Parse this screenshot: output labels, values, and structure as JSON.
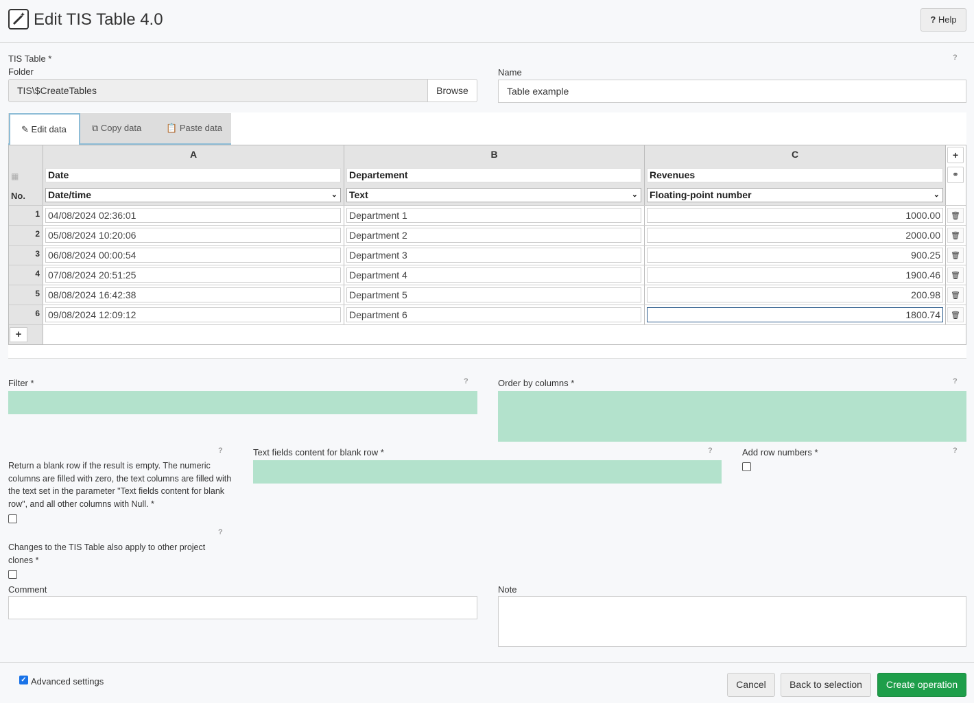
{
  "header": {
    "title": "Edit TIS Table 4.0",
    "help_label": "Help"
  },
  "form": {
    "tis_table_label": "TIS Table *",
    "folder_label": "Folder",
    "folder_value": "TIS\\$CreateTables",
    "browse_label": "Browse",
    "name_label": "Name",
    "name_value": "Table example"
  },
  "tabs": [
    {
      "label": "Edit data",
      "icon": "edit-icon"
    },
    {
      "label": "Copy data",
      "icon": "copy-icon"
    },
    {
      "label": "Paste data",
      "icon": "paste-icon"
    }
  ],
  "grid": {
    "no_label": "No.",
    "columns": [
      {
        "letter": "A",
        "name": "Date",
        "type": "Date/time"
      },
      {
        "letter": "B",
        "name": "Departement",
        "type": "Text"
      },
      {
        "letter": "C",
        "name": "Revenues",
        "type": "Floating-point number"
      }
    ],
    "rows": [
      {
        "no": "1",
        "a": "04/08/2024 02:36:01",
        "b": "Department 1",
        "c": "1000.00"
      },
      {
        "no": "2",
        "a": "05/08/2024 10:20:06",
        "b": "Department 2",
        "c": "2000.00"
      },
      {
        "no": "3",
        "a": "06/08/2024 00:00:54",
        "b": "Department 3",
        "c": "900.25"
      },
      {
        "no": "4",
        "a": "07/08/2024 20:51:25",
        "b": "Department 4",
        "c": "1900.46"
      },
      {
        "no": "5",
        "a": "08/08/2024 16:42:38",
        "b": "Department 5",
        "c": "200.98"
      },
      {
        "no": "6",
        "a": "09/08/2024 12:09:12",
        "b": "Department 6",
        "c": "1800.74"
      }
    ]
  },
  "params": {
    "filter_label": "Filter *",
    "order_label": "Order by columns *",
    "blank_row_text": "Return a blank row if the result is empty. The numeric columns are filled with zero, the text columns are filled with the text set in the parameter \"Text fields content for blank row\", and all other columns with Null. *",
    "text_fields_label": "Text fields content for blank row *",
    "add_row_numbers_label": "Add row numbers *",
    "clones_text": "Changes to the TIS Table also apply to other project clones *",
    "comment_label": "Comment",
    "note_label": "Note",
    "help_mark": "?"
  },
  "footer": {
    "advanced_label": "Advanced settings",
    "advanced_checked": true,
    "cancel_label": "Cancel",
    "back_label": "Back to selection",
    "create_label": "Create operation"
  },
  "colors": {
    "accent_green": "#1e9e4a",
    "param_fill": "#b3e2cc",
    "tab_border": "#8dbcd6"
  }
}
